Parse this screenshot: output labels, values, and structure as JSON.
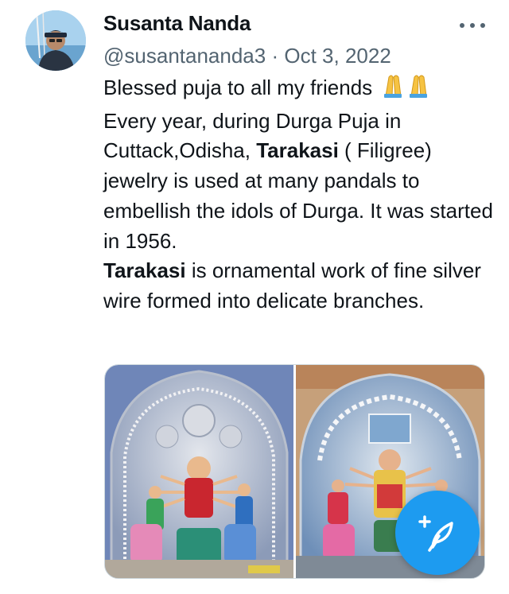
{
  "author": {
    "name": "Susanta Nanda",
    "handle": "@susantananda3",
    "separator": "·",
    "date": "Oct 3, 2022"
  },
  "tweet": {
    "line1": "Blessed puja to all my friends ",
    "emoji": "folded-hands",
    "para1_pre": "Every year, during Durga Puja in Cuttack,Odisha, ",
    "para1_bold": "Tarakasi",
    "para1_post": " ( Filigree) jewelry is used at many pandals to embellish the idols of Durga. It was started in 1956.",
    "para2_bold": "Tarakasi",
    "para2_post": " is ornamental work of fine silver wire formed into delicate branches."
  },
  "media": {
    "images": [
      {
        "icon": "durga-idol-photo-1"
      },
      {
        "icon": "durga-idol-photo-2"
      }
    ]
  },
  "actions": {
    "more_icon": "more-options-icon",
    "compose_icon": "compose-tweet-icon",
    "accent_color": "#1d9bf0"
  }
}
